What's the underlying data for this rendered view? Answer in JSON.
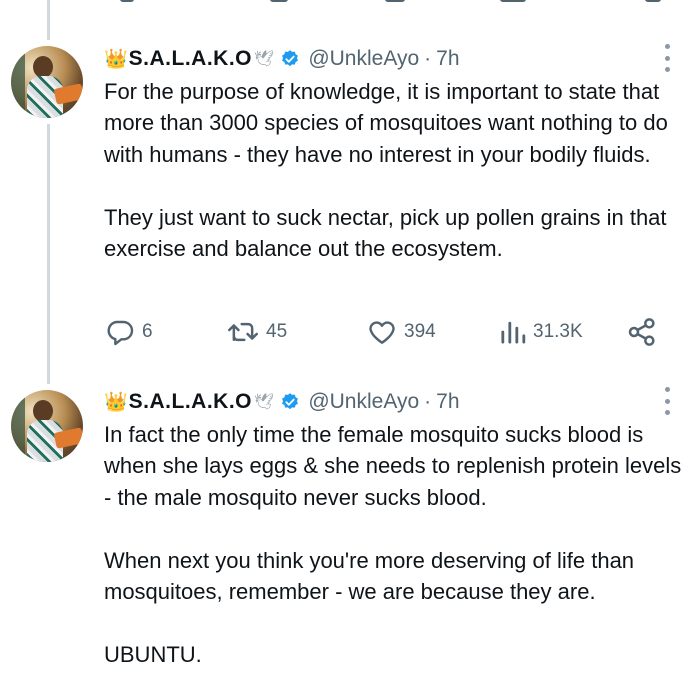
{
  "tweets": [
    {
      "crown": "👑",
      "name": "S.A.L.A.K.O",
      "dove": "🕊",
      "handle": "@UnkleAyo",
      "separator": "·",
      "time": "7h",
      "text": "For the purpose of knowledge, it is important to state that more than 3000 species of mosquitoes want nothing to do with humans - they have no interest in your bodily fluids.\n\nThey just want to suck nectar, pick up pollen grains in that exercise and balance out the ecosystem.",
      "stats": {
        "replies": "6",
        "reposts": "45",
        "likes": "394",
        "views": "31.3K"
      }
    },
    {
      "crown": "👑",
      "name": "S.A.L.A.K.O",
      "dove": "🕊",
      "handle": "@UnkleAyo",
      "separator": "·",
      "time": "7h",
      "text": "In fact the only time the female mosquito sucks blood is when she lays eggs & she needs to replenish protein levels - the male mosquito never sucks blood.\n\nWhen next you think you're more deserving of life than mosquitoes, remember - we are because they are.\n\nUBUNTU."
    }
  ],
  "icons": {
    "verified": "verified-badge-icon",
    "more": "more-vertical-icon",
    "reply": "reply-icon",
    "repost": "repost-icon",
    "like": "heart-icon",
    "views": "views-icon",
    "share": "share-icon"
  },
  "colors": {
    "verified": "#1d9bf0",
    "text": "#0f1419",
    "secondary": "#536471",
    "thread_line": "#cfd9de"
  }
}
